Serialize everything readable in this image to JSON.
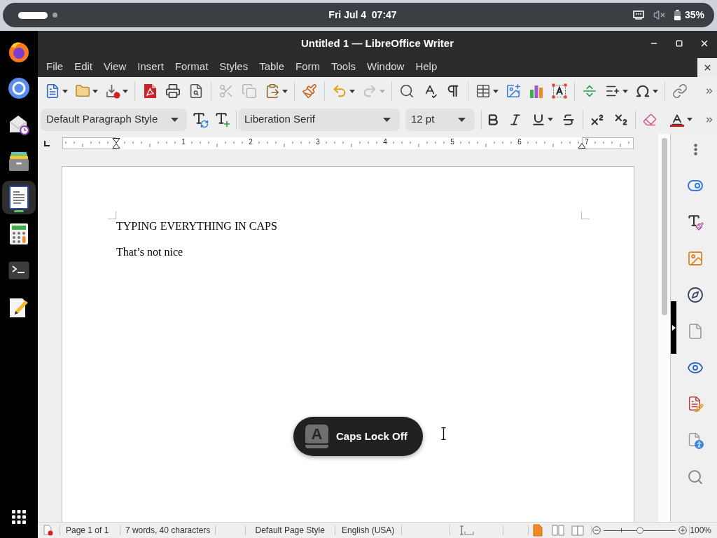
{
  "top_bar": {
    "workspaces": [
      {
        "selected": true
      },
      {
        "selected": false
      }
    ],
    "date": "Fri Jul 4",
    "time": "07:47",
    "battery": "35%"
  },
  "dock": {
    "apps": [
      {
        "kind": "browser_fox",
        "selected": false
      },
      {
        "kind": "browser_ring",
        "selected": false
      },
      {
        "kind": "mail",
        "selected": false
      },
      {
        "kind": "files",
        "selected": false
      },
      {
        "kind": "writer",
        "selected": true
      },
      {
        "kind": "calculator",
        "selected": false
      },
      {
        "kind": "terminal",
        "selected": false
      },
      {
        "kind": "text_editor",
        "selected": false
      }
    ]
  },
  "window": {
    "title": "Untitled 1 — LibreOffice Writer"
  },
  "menu": [
    "File",
    "Edit",
    "View",
    "Insert",
    "Format",
    "Styles",
    "Table",
    "Form",
    "Tools",
    "Window",
    "Help"
  ],
  "standard_toolbar": [
    {
      "kind": "new",
      "disabled": false
    },
    {
      "kind": "open",
      "disabled": false
    },
    {
      "kind": "save",
      "disabled": false
    },
    {
      "kind": "separator"
    },
    {
      "kind": "export_pdf",
      "disabled": false
    },
    {
      "kind": "print",
      "disabled": false
    },
    {
      "kind": "print_preview",
      "disabled": false
    },
    {
      "kind": "separator"
    },
    {
      "kind": "cut",
      "disabled": true
    },
    {
      "kind": "copy",
      "disabled": true
    },
    {
      "kind": "paste",
      "disabled": false
    },
    {
      "kind": "separator"
    },
    {
      "kind": "clone_formatting",
      "disabled": false
    },
    {
      "kind": "separator"
    },
    {
      "kind": "undo",
      "disabled": false
    },
    {
      "kind": "redo",
      "disabled": true
    },
    {
      "kind": "separator"
    },
    {
      "kind": "find_replace",
      "disabled": false
    },
    {
      "kind": "spelling",
      "disabled": false
    },
    {
      "kind": "formatting_marks",
      "disabled": false
    },
    {
      "kind": "separator"
    },
    {
      "kind": "table",
      "disabled": false
    },
    {
      "kind": "image",
      "disabled": false
    },
    {
      "kind": "chart",
      "disabled": false
    },
    {
      "kind": "text_box",
      "disabled": false
    },
    {
      "kind": "separator"
    },
    {
      "kind": "page_break",
      "disabled": false
    },
    {
      "kind": "field",
      "disabled": false
    },
    {
      "kind": "special_character",
      "disabled": false
    },
    {
      "kind": "separator"
    },
    {
      "kind": "hyperlink",
      "disabled": false
    }
  ],
  "formatting_toolbar": {
    "paragraph_style": "Default Paragraph Style",
    "font_name": "Liberation Serif",
    "font_size": "12 pt"
  },
  "ruler": {
    "labels": [
      "1",
      "2",
      "3",
      "4",
      "5",
      "6",
      "7"
    ]
  },
  "document": {
    "paragraphs": [
      "TYPING EVERYTHING IN CAPS",
      "That’s not nice"
    ]
  },
  "notification": {
    "key": "A",
    "text": "Caps Lock Off"
  },
  "status_bar": {
    "page": "Page 1 of 1",
    "words": "7 words, 40 characters",
    "page_style": "Default Page Style",
    "language": "English (USA)",
    "view_layouts": [
      {
        "selected": true
      },
      {
        "selected": false
      },
      {
        "selected": false
      }
    ],
    "zoom": {
      "level": 0.5,
      "reading": "100%"
    }
  }
}
